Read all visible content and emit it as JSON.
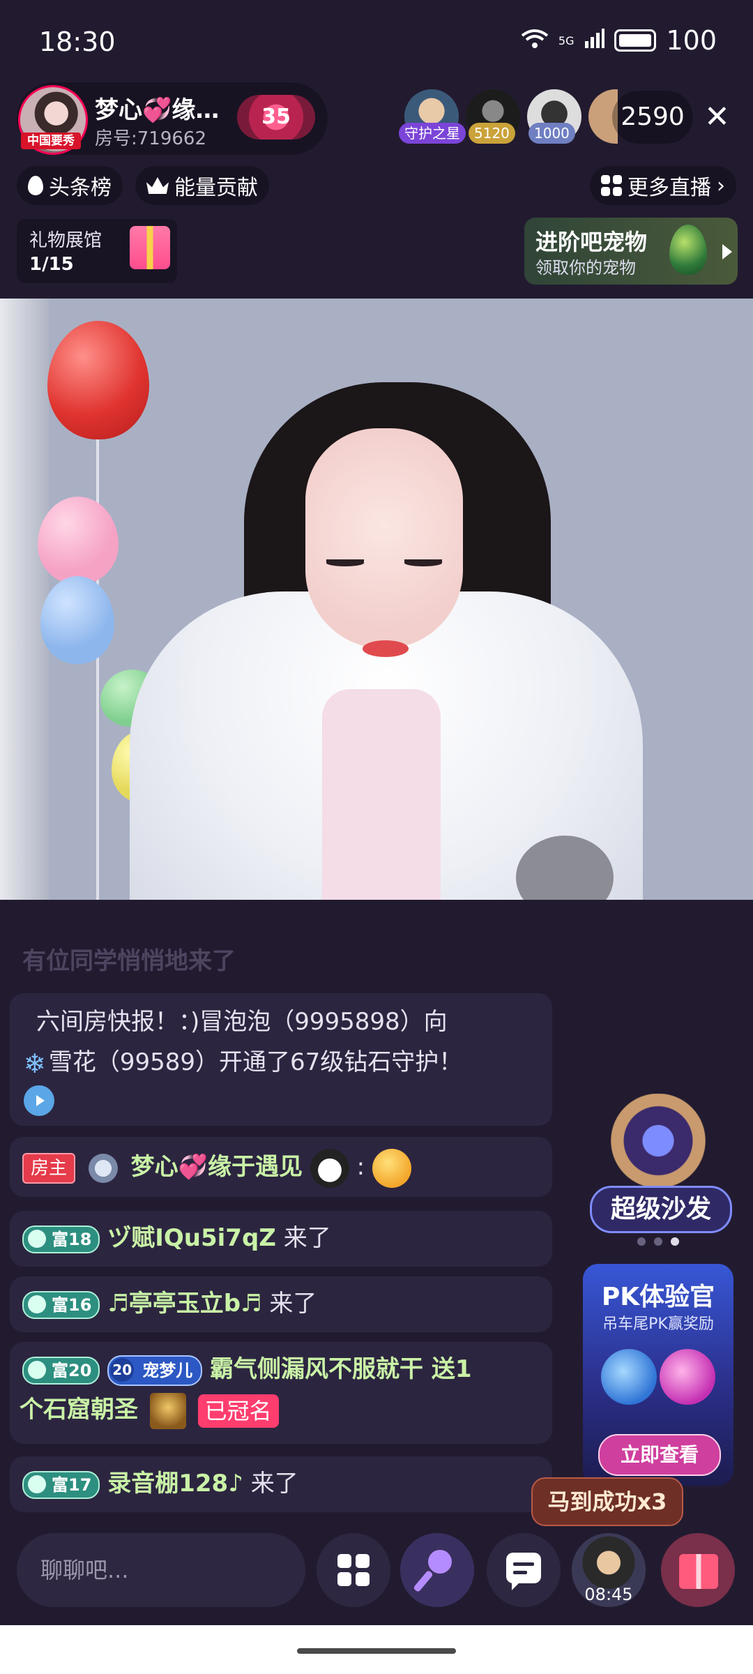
{
  "status_bar": {
    "time": "18:30",
    "network": "5G",
    "battery": "100"
  },
  "host": {
    "name": "梦心💞缘…",
    "room_no": "房号:719662",
    "avatar_tag": "中国要秀",
    "level": "35"
  },
  "viewers": [
    {
      "badge": "守护之星"
    },
    {
      "badge": "5120"
    },
    {
      "badge": "1000"
    }
  ],
  "audience_count": "2590",
  "close_label": "✕",
  "chips": {
    "headlines": "头条榜",
    "energy": "能量贡献",
    "more_live": "更多直播"
  },
  "gift_hall": {
    "title": "礼物展馆",
    "count": "1/15"
  },
  "pet_banner": {
    "title": "进阶吧宠物",
    "subtitle": "领取你的宠物"
  },
  "chat": {
    "faded": "有位同学悄悄地来了",
    "broadcast": {
      "line1": "六间房快报！：)冒泡泡（9995898）向",
      "snow": "❄",
      "line2": "雪花（99589）开通了67级钻石守护！"
    },
    "host_msg": {
      "tag": "房主",
      "name": "梦心💞缘于遇见",
      "colon": ":"
    },
    "m1": {
      "badge": "富18",
      "name": "ヅ赋IQu5i7qZ",
      "action": "来了"
    },
    "m2": {
      "badge": "富16",
      "name": "♬亭亭玉立b♬",
      "action": "来了"
    },
    "m3": {
      "badge": "富20",
      "pet_lv": "20",
      "pet_name": "宠梦儿",
      "text1": "霸气侧漏风不服就干 送1",
      "text2": "个石窟朝圣",
      "named": "已冠名"
    },
    "m4": {
      "badge": "富17",
      "name": "录音棚128♪",
      "action": "来了"
    }
  },
  "promo": {
    "sofa": "超级沙发",
    "pk_title": "PK体验官",
    "pk_sub": "吊车尾PK赢奖励",
    "pk_button": "立即查看"
  },
  "toast": "马到成功x3",
  "bottom": {
    "input_placeholder": "聊聊吧...",
    "timer": "08:45"
  }
}
